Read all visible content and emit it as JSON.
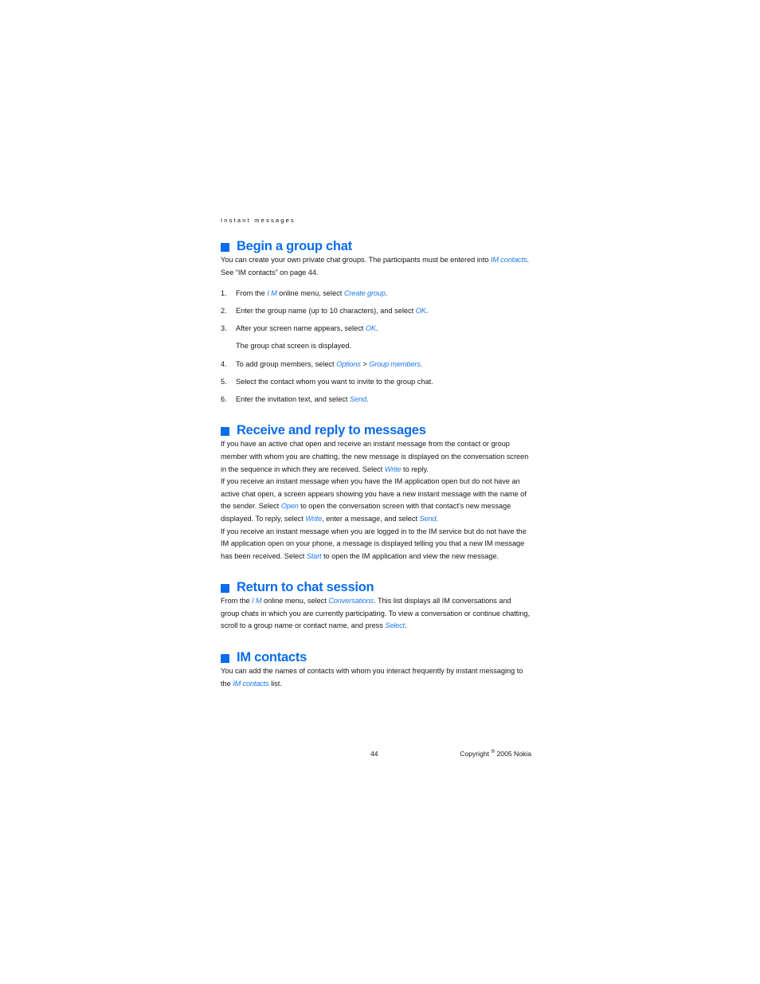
{
  "running_header": "Instant messages",
  "accent_color": "#0b6ced",
  "term_color": "#1b7aee",
  "body_color": "#161616",
  "sections": [
    {
      "id": "begin-a-group-chat",
      "heading": "Begin a group chat",
      "intro_a": "You can create your own private chat groups. The participants must be entered into ",
      "intro_term": "IM contacts",
      "intro_b": ". See “IM contacts” on page 44.",
      "steps": [
        {
          "num": "1.",
          "a": "From the ",
          "t1": "I M",
          "b": " online menu, select ",
          "t2": "Create group",
          "c": "."
        },
        {
          "num": "2.",
          "a": "Enter the group name (up to 10 characters), and select ",
          "t1": "OK",
          "b": "."
        },
        {
          "num": "3.",
          "a": "After your screen name appears, select ",
          "t1": "OK",
          "b": "."
        },
        {
          "num": "4.",
          "a": "To add group members, select ",
          "t1": "Options",
          "b": " > ",
          "t2": "Group members",
          "c": "."
        },
        {
          "num": "5.",
          "a": "Select the contact whom you want to invite to the group chat."
        },
        {
          "num": "6.",
          "a": "Enter the invitation text, and select ",
          "t1": "Send",
          "b": "."
        }
      ],
      "substep": "The group chat screen is displayed."
    },
    {
      "id": "receive-and-reply-to-messages",
      "heading": "Receive and reply to messages",
      "p1_a": "If you have an active chat open and receive an instant message from the contact or group member with whom you are chatting, the new message is displayed on the conversation screen in the sequence in which they are received. Select ",
      "p1_t1": "Write",
      "p1_b": " to reply.",
      "p2_a": "If you receive an instant message when you have the IM application open but do not have an active chat open, a screen appears showing you have a new instant message with the name of the sender. Select ",
      "p2_t1": "Open",
      "p2_b": " to open the conversation screen with that contact's new message displayed. To reply, select ",
      "p2_t2": "Write",
      "p2_c": ", enter a message, and select ",
      "p2_t3": "Send",
      "p2_d": ".",
      "p3_a": "If you receive an instant message when you are logged in to the IM service but do not have the IM application open on your phone, a message is displayed telling you that a new IM message has been received. Select ",
      "p3_t1": "Start",
      "p3_b": " to open the IM application and view the new message."
    },
    {
      "id": "return-to-chat-session",
      "heading": "Return to chat session",
      "p1_a": "From the ",
      "p1_t1": "I M",
      "p1_b": " online menu, select ",
      "p1_t2": "Conversations",
      "p1_c": ". This list displays all IM conversations and group chats in which you are currently participating. To view a conversation or continue chatting, scroll to a group name or contact name, and press ",
      "p1_t3": "Select",
      "p1_d": "."
    },
    {
      "id": "im-contacts",
      "heading": "IM contacts",
      "p1_a": "You can add the names of contacts with whom you interact frequently by instant messaging to the ",
      "p1_t1": "IM contacts",
      "p1_b": " list."
    }
  ],
  "footer": {
    "page_number": "44",
    "copyright_prefix": "Copyright ",
    "copyright_symbol": "®",
    "copyright_suffix": " 2005 Nokia"
  }
}
